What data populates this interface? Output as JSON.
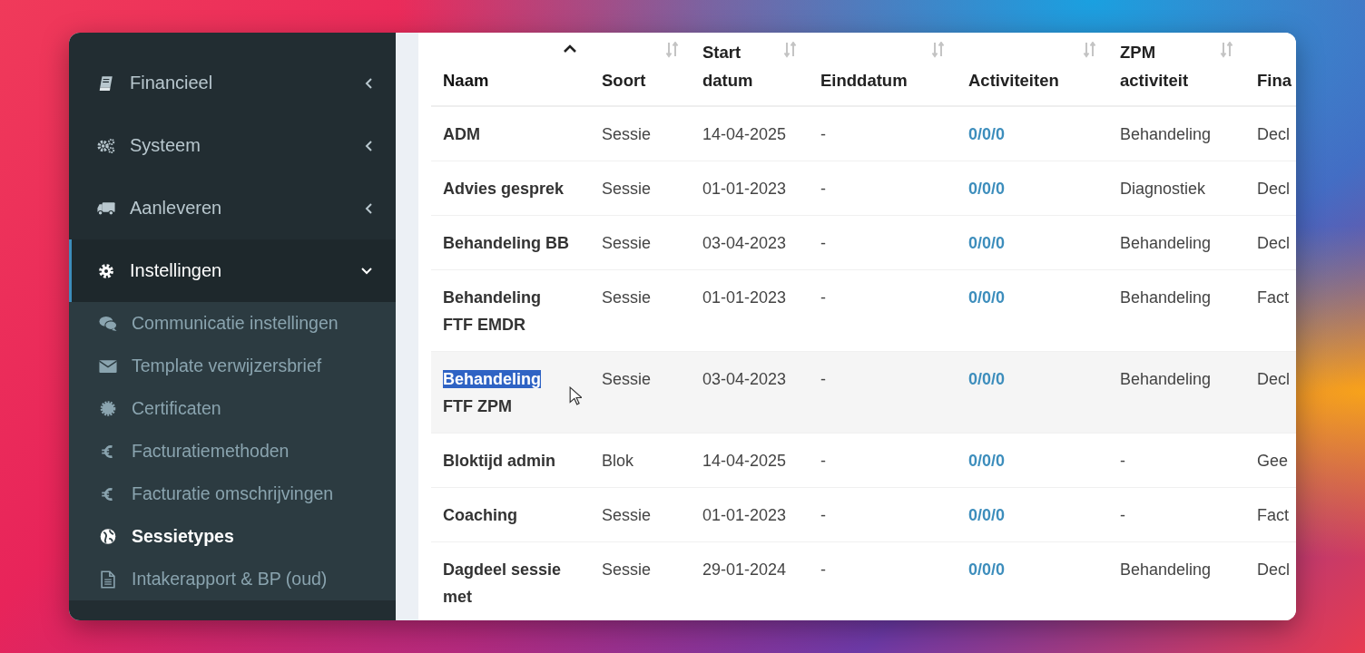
{
  "sidebar": {
    "items": [
      {
        "label": "Financieel",
        "expanded": false
      },
      {
        "label": "Systeem",
        "expanded": false
      },
      {
        "label": "Aanleveren",
        "expanded": false
      },
      {
        "label": "Instellingen",
        "expanded": true,
        "children": [
          {
            "label": "Communicatie instellingen",
            "selected": false
          },
          {
            "label": "Template verwijzersbrief",
            "selected": false
          },
          {
            "label": "Certificaten",
            "selected": false
          },
          {
            "label": "Facturatiemethoden",
            "selected": false
          },
          {
            "label": "Facturatie omschrijvingen",
            "selected": false
          },
          {
            "label": "Sessietypes",
            "selected": true
          },
          {
            "label": "Intakerapport & BP (oud)",
            "selected": false
          }
        ]
      }
    ]
  },
  "table": {
    "columns": [
      {
        "label": "Naam",
        "sortable": true,
        "sorted": true
      },
      {
        "label": "Soort",
        "sortable": true,
        "sorted": false
      },
      {
        "label": "Start datum",
        "sortable": true,
        "sorted": false
      },
      {
        "label": "Einddatum",
        "sortable": true,
        "sorted": false
      },
      {
        "label": "Activiteiten",
        "sortable": true,
        "sorted": false
      },
      {
        "label": "ZPM activiteit",
        "sortable": true,
        "sorted": false
      },
      {
        "label": "Fina"
      }
    ],
    "rows": [
      {
        "name": "ADM",
        "soort": "Sessie",
        "start": "14-04-2025",
        "eind": "-",
        "activiteiten": "0/0/0",
        "zpm": "Behandeling",
        "column_7": "Decl",
        "hovered": false
      },
      {
        "name": "Advies gesprek",
        "soort": "Sessie",
        "start": "01-01-2023",
        "eind": "-",
        "activiteiten": "0/0/0",
        "zpm": "Diagnostiek",
        "column_7": "Decl",
        "hovered": false
      },
      {
        "name": "Behandeling BB",
        "soort": "Sessie",
        "start": "03-04-2023",
        "eind": "-",
        "activiteiten": "0/0/0",
        "zpm": "Behandeling",
        "column_7": "Decl",
        "hovered": false
      },
      {
        "name": "Behandeling FTF EMDR",
        "soort": "Sessie",
        "start": "01-01-2023",
        "eind": "-",
        "activiteiten": "0/0/0",
        "zpm": "Behandeling",
        "column_7": "Fact",
        "hovered": false
      },
      {
        "name_parts": [
          {
            "text": "Behandeling",
            "selected": true
          },
          {
            "text": " FTF ZPM",
            "selected": false
          }
        ],
        "soort": "Sessie",
        "start": "03-04-2023",
        "eind": "-",
        "activiteiten": "0/0/0",
        "zpm": "Behandeling",
        "column_7": "Decl",
        "hovered": true
      },
      {
        "name": "Bloktijd admin",
        "soort": "Blok",
        "start": "14-04-2025",
        "eind": "-",
        "activiteiten": "0/0/0",
        "zpm": "-",
        "column_7": "Gee",
        "hovered": false
      },
      {
        "name": "Coaching",
        "soort": "Sessie",
        "start": "01-01-2023",
        "eind": "-",
        "activiteiten": "0/0/0",
        "zpm": "-",
        "column_7": "Fact",
        "hovered": false
      },
      {
        "name": "Dagdeel sessie met",
        "soort": "Sessie",
        "start": "29-01-2024",
        "eind": "-",
        "activiteiten": "0/0/0",
        "zpm": "Behandeling",
        "column_7": "Decl",
        "hovered": false
      }
    ]
  }
}
